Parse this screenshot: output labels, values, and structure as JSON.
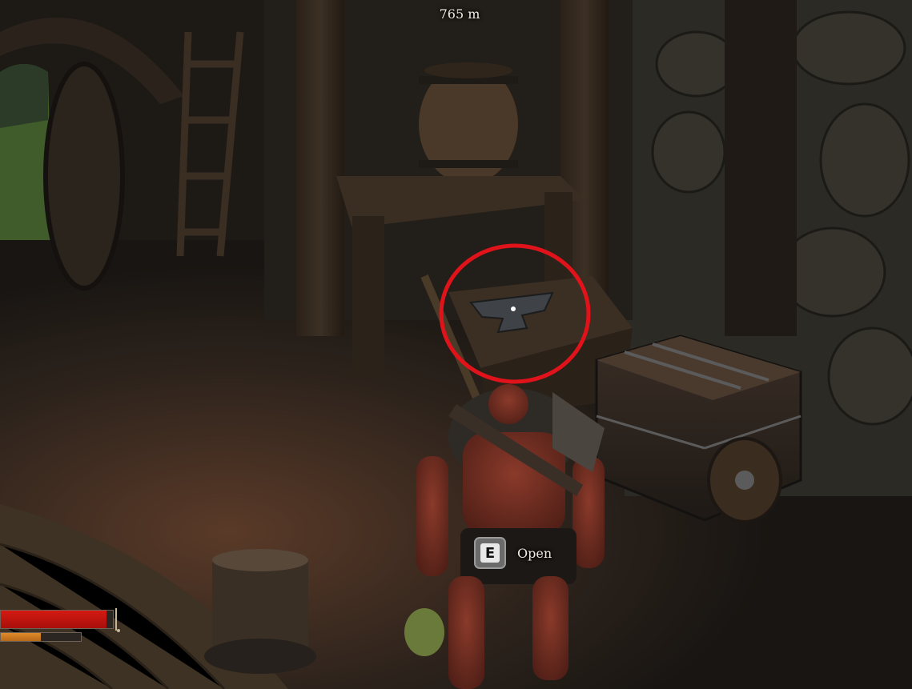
{
  "hud": {
    "distance": "765 m",
    "interaction": {
      "key": "E",
      "action": "Open"
    },
    "health": {
      "fraction": 0.94,
      "color": "#c8150f"
    },
    "stamina": {
      "fraction": 0.5,
      "color": "#d07e24"
    }
  },
  "highlight": {
    "color": "#e0131b",
    "target": "anvil"
  },
  "icons": [
    "anvil-icon",
    "barrel-icon",
    "chest-icon",
    "shield-icon",
    "crosshair-icon"
  ]
}
